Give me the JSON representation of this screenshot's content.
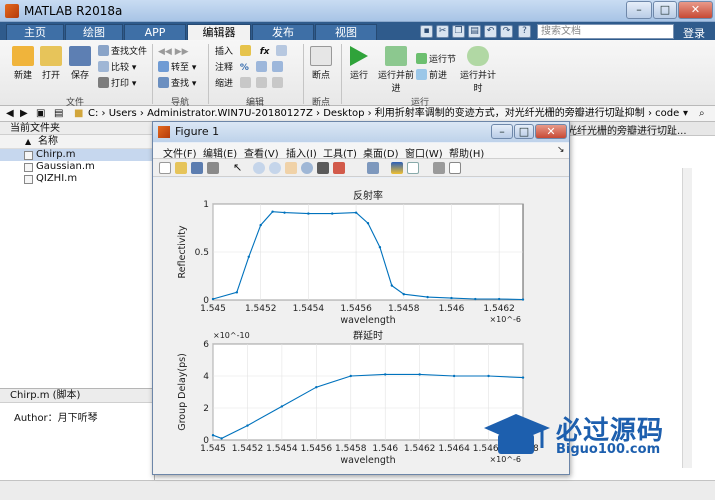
{
  "window": {
    "title": "MATLAB R2018a"
  },
  "tabs": [
    "主页",
    "绘图",
    "APP",
    "编辑器",
    "发布",
    "视图"
  ],
  "search": {
    "placeholder": "搜索文档"
  },
  "login_label": "登录",
  "ribbon": {
    "file_group": {
      "label": "文件",
      "new": "新建",
      "open": "打开",
      "save": "保存",
      "find_files": "查找文件",
      "compare": "比较",
      "print": "打印"
    },
    "nav_group": {
      "label": "导航",
      "goto": "转至",
      "find": "查找"
    },
    "edit_group": {
      "label": "编辑",
      "insert": "插入",
      "comment": "注释",
      "indent": "缩进",
      "fx": "fx"
    },
    "breakpoint_group": {
      "label": "断点",
      "breakpoint": "断点"
    },
    "run_group": {
      "label": "运行",
      "run": "运行",
      "run_advance": "运行并前进",
      "run_section": "运行节",
      "advance": "前进",
      "run_time": "运行并计时"
    }
  },
  "address": {
    "path": "C: › Users › Administrator.WIN7U-20180127Z › Desktop › 利用折射率调制的变迹方式，对光纤光栅的旁瓣进行切趾抑制 › code",
    "path_tail": "光纤光栅的旁瓣进行切趾..."
  },
  "current_folder": {
    "header": "当前文件夹",
    "column": "名称",
    "files": [
      "Chirp.m",
      "Gaussian.m",
      "QIZHI.m"
    ]
  },
  "details": {
    "header": "Chirp.m (脚本)",
    "author": "Author：月下听琴"
  },
  "figure": {
    "title": "Figure 1",
    "menus": [
      "文件(F)",
      "编辑(E)",
      "查看(V)",
      "插入(I)",
      "工具(T)",
      "桌面(D)",
      "窗口(W)",
      "帮助(H)"
    ]
  },
  "watermark": {
    "main": "必过源码",
    "sub": "Biguo100.com"
  },
  "colors": {
    "plot_line": "#0072bd",
    "tab_active": "#f2f2f2",
    "tabbar": "#2f5b8c",
    "watermark": "#1d5fae"
  },
  "chart_data": [
    {
      "type": "line",
      "title": "反射率",
      "xlabel": "wavelength",
      "ylabel": "Reflectivity",
      "x_exponent": "×10^-6",
      "xlim": [
        1.545,
        1.5463
      ],
      "ylim": [
        0,
        1
      ],
      "xticks": [
        "1.545",
        "1.5452",
        "1.5454",
        "1.5456",
        "1.5458",
        "1.546",
        "1.5462"
      ],
      "yticks": [
        "0",
        "0.5",
        "1"
      ],
      "grid": true,
      "x": [
        1.545,
        1.5451,
        1.54515,
        1.5452,
        1.54525,
        1.5453,
        1.5454,
        1.5455,
        1.5456,
        1.54565,
        1.5457,
        1.54575,
        1.5458,
        1.5459,
        1.546,
        1.5461,
        1.5462,
        1.5463
      ],
      "y": [
        0.01,
        0.08,
        0.45,
        0.78,
        0.92,
        0.91,
        0.9,
        0.9,
        0.91,
        0.8,
        0.55,
        0.15,
        0.06,
        0.03,
        0.02,
        0.01,
        0.01,
        0.005
      ]
    },
    {
      "type": "line",
      "title": "群延时",
      "xlabel": "wavelength",
      "ylabel": "Group Delay(ps)",
      "x_exponent": "×10^-6",
      "y_exponent": "×10^-10",
      "xlim": [
        1.545,
        1.5468
      ],
      "ylim": [
        0,
        6
      ],
      "xticks": [
        "1.545",
        "1.5452",
        "1.5454",
        "1.5456",
        "1.5458",
        "1.546",
        "1.5462",
        "1.5464",
        "1.5466",
        "1.5468"
      ],
      "yticks": [
        "0",
        "2",
        "4",
        "6"
      ],
      "grid": true,
      "x": [
        1.545,
        1.54505,
        1.5452,
        1.5454,
        1.5456,
        1.5458,
        1.546,
        1.5462,
        1.5464,
        1.5466,
        1.5468
      ],
      "y": [
        0.3,
        0.1,
        0.9,
        2.1,
        3.3,
        4.0,
        4.1,
        4.1,
        4.0,
        4.0,
        3.9
      ]
    }
  ]
}
